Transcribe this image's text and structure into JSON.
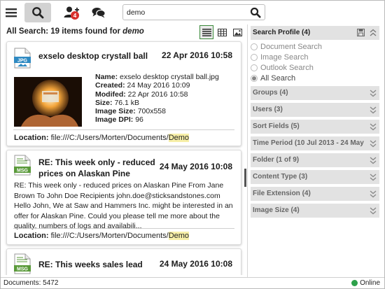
{
  "toolbar": {
    "search_value": "demo",
    "notification_count": "4"
  },
  "results": {
    "header_prefix": "All Search: 19 items found for ",
    "header_query": "demo",
    "cards": [
      {
        "icon": "jpg-file-icon",
        "icon_label": "JPG",
        "title": "exselo desktop crystall ball",
        "date": "22 Apr 2016 10:58",
        "meta": [
          {
            "label": "Name",
            "value": "exselo desktop crystall ball.jpg"
          },
          {
            "label": "Created",
            "value": "24 May 2016 10:09"
          },
          {
            "label": "Modifed",
            "value": "22 Apr 2016 10:58"
          },
          {
            "label": "Size",
            "value": "76.1 kB"
          },
          {
            "label": "Image Size",
            "value": "700x558"
          },
          {
            "label": "Image DPI",
            "value": "96"
          }
        ],
        "location_label": "Location",
        "location_path": "file:///C:/Users/Morten/Documents/",
        "location_hl": "Demo"
      },
      {
        "icon": "msg-file-icon",
        "icon_label": "MSG",
        "title_line1": "RE: This week only - reduced",
        "title_line2": "prices on Alaskan Pine",
        "date": "24 May 2016 10:08",
        "body": "RE: This week only - reduced prices on Alaskan Pine From Jane Brown To John Doe Recipients john.doe@sticksandstones.com Hello John,    We at Saw and Hammers Inc. might be interested in an offer for Alaskan Pine. Could you please tell me more about the quality, numbers of logs and availabili...",
        "location_label": "Location",
        "location_path": "file:///C:/Users/Morten/Documents/",
        "location_hl": "Demo"
      },
      {
        "icon": "msg-file-icon",
        "icon_label": "MSG",
        "title": "RE: This weeks sales lead",
        "date": "24 May 2016 10:08"
      }
    ]
  },
  "sidebar": {
    "profile": {
      "title": "Search Profile (4)",
      "options": [
        "Document Search",
        "Image Search",
        "Outlook Search",
        "All Search"
      ],
      "selected": "All Search"
    },
    "sections": [
      "Groups (4)",
      "Users (3)",
      "Sort Fields (5)",
      "Time Period (10 Jul 2013 - 24 May 2016)",
      "Folder (1 of 9)",
      "Content Type (3)",
      "File Extension (4)",
      "Image Size (4)"
    ]
  },
  "status": {
    "documents": "Documents: 5472",
    "connection": "Online"
  },
  "colors": {
    "accent_green": "#2da14a",
    "badge_red": "#d9302c",
    "highlight": "#f7efa8",
    "section_bg": "#e2e2e2"
  }
}
